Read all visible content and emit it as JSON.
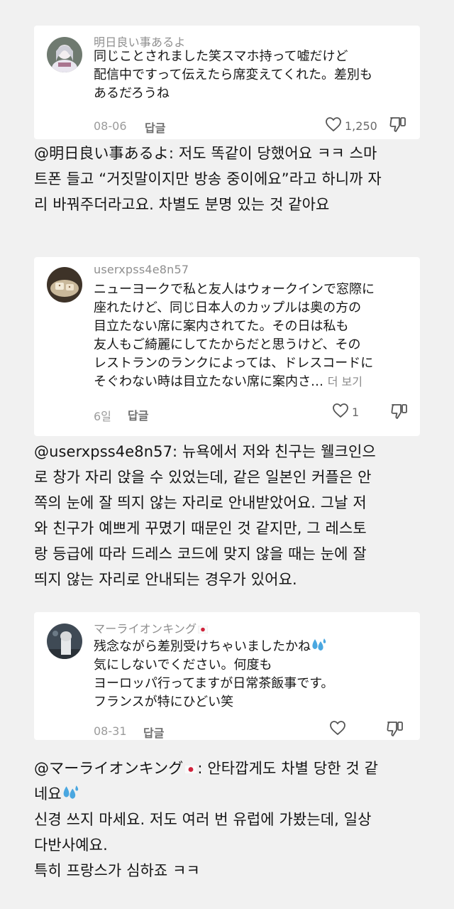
{
  "comments": [
    {
      "username": "明日良い事あるよ",
      "lines": [
        "同じことされました笑スマホ持って嘘だけど",
        "配信中ですって伝えたら席変えてくれた。差別も",
        "あるだろうね"
      ],
      "date": "08-06",
      "reply_label": "답글",
      "like_count": "1,250",
      "translation": [
        "@明日良い事あるよ: 저도 똑같이 당했어요 ㅋㅋ 스마",
        "트폰 들고 “거짓말이지만 방송 중이에요”라고 하니까 자",
        "리 바꿔주더라고요. 차별도 분명 있는 것 같아요"
      ]
    },
    {
      "username": "userxpss4e8n57",
      "lines": [
        "ニューヨークで私と友人はウォークインで窓際に",
        "座れたけど、同じ日本人のカップルは奥の方の",
        "目立たない席に案内されてた。その日は私も",
        "友人もご綺麗にしてたからだと思うけど、その",
        "レストランのランクによっては、ドレスコードに",
        "そぐわない時は目立たない席に案内さ…"
      ],
      "more_label": "더 보기",
      "date": "6일",
      "reply_label": "답글",
      "like_count": "1",
      "translation": [
        "@userxpss4e8n57: 뉴욕에서 저와 친구는 웰크인으",
        "로 창가 자리 앉을 수 있었는데, 같은 일본인 커플은 안",
        "쪽의 눈에 잘 띄지 않는 자리로 안내받았어요. 그날 저",
        "와 친구가 예쁘게 꾸몄기 때문인 것 같지만, 그 레스토",
        "랑 등급에 따라 드레스 코드에 맞지 않을 때는 눈에 잘",
        "띄지 않는 자리로 안내되는 경우가 있어요."
      ]
    },
    {
      "username": "マーライオンキング",
      "lines": [
        "残念ながら差別受けちゃいましたかね",
        "気にしないでください。何度も",
        "ヨーロッパ行ってますが日常茶飯事です。",
        "フランスが特にひどい笑"
      ],
      "date": "08-31",
      "reply_label": "답글",
      "translation": [
        "@マーライオンキング",
        ": 안타깝게도 차별 당한 것 같",
        "네요",
        "신경 쓰지 마세요. 저도 여러 번 유럽에 가봤는데, 일상",
        "다반사예요.",
        "특히 프랑스가 심하죠 ㅋㅋ"
      ]
    }
  ],
  "icons": {
    "like": "heart-outline-icon",
    "dislike": "thumbs-down-outline-icon",
    "sweat": "sweat-droplets-emoji",
    "flag": "japan-flag-emoji"
  },
  "colors": {
    "background": "#f1f1f1",
    "card": "#ffffff",
    "meta": "#9b9b9b",
    "text": "#161616"
  }
}
